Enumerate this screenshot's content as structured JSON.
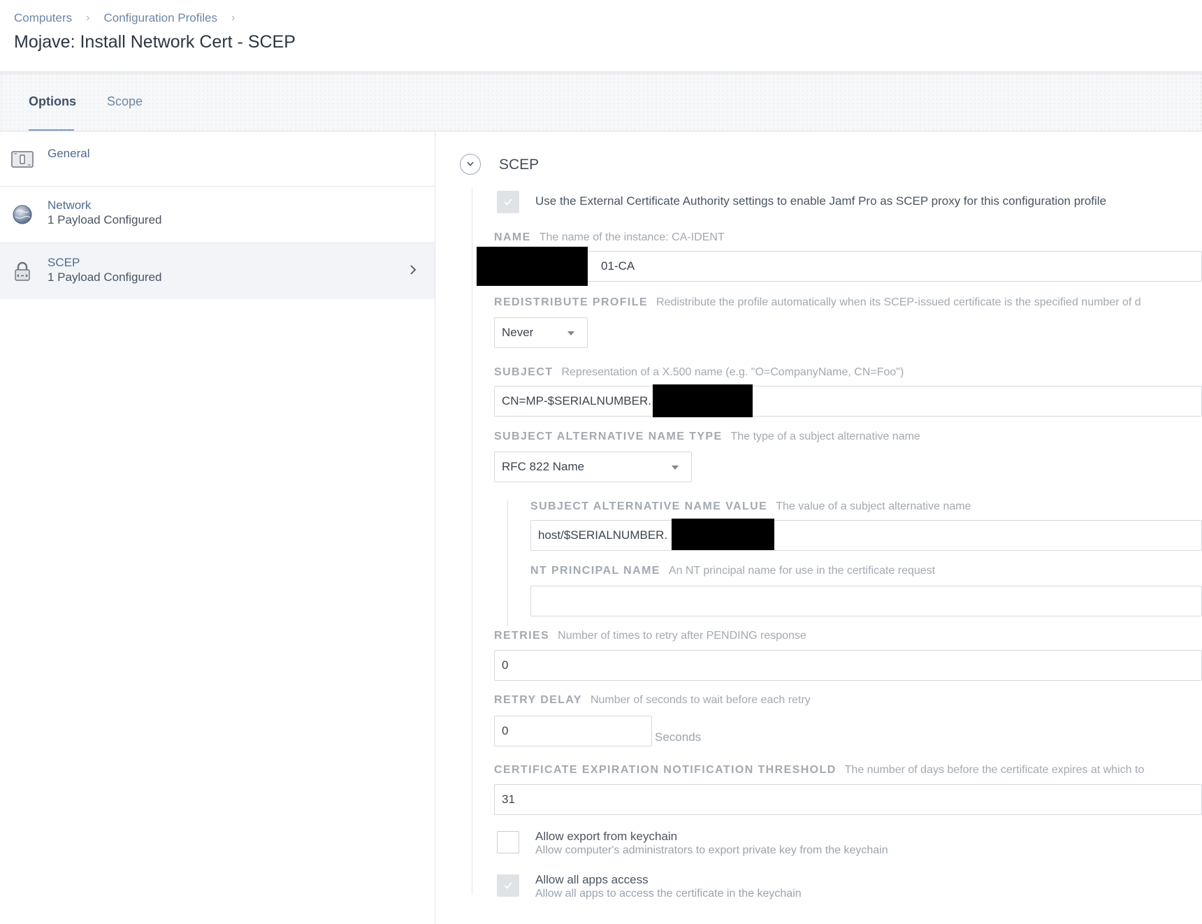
{
  "breadcrumb": {
    "items": [
      "Computers",
      "Configuration Profiles"
    ]
  },
  "page": {
    "title": "Mojave: Install Network Cert - SCEP"
  },
  "tabs": {
    "options": "Options",
    "scope": "Scope"
  },
  "sidebar": {
    "items": [
      {
        "label": "General",
        "icon": "switch-icon"
      },
      {
        "label": "Network",
        "sublabel": "1 Payload Configured",
        "icon": "globe-icon"
      },
      {
        "label": "SCEP",
        "sublabel": "1 Payload Configured",
        "icon": "padlock-icon",
        "selected": true
      }
    ]
  },
  "section": {
    "title": "SCEP",
    "external_ca_checkbox": {
      "label": "Use the External Certificate Authority settings to enable Jamf Pro as SCEP proxy for this configuration profile",
      "checked": true
    }
  },
  "fields": {
    "name": {
      "label": "NAME",
      "description": "The name of the instance: CA-IDENT",
      "value": "01-CA"
    },
    "redistribute": {
      "label": "REDISTRIBUTE PROFILE",
      "description": "Redistribute the profile automatically when its SCEP-issued certificate is the specified number of d",
      "value": "Never"
    },
    "subject": {
      "label": "SUBJECT",
      "description": "Representation of a X.500 name (e.g. \"O=CompanyName, CN=Foo\")",
      "value": "CN=MP-$SERIALNUMBER."
    },
    "san_type": {
      "label": "SUBJECT ALTERNATIVE NAME TYPE",
      "description": "The type of a subject alternative name",
      "value": "RFC 822 Name"
    },
    "san_value": {
      "label": "SUBJECT ALTERNATIVE NAME VALUE",
      "description": "The value of a subject alternative name",
      "value": "host/$SERIALNUMBER."
    },
    "nt_principal": {
      "label": "NT PRINCIPAL NAME",
      "description": "An NT principal name for use in the certificate request",
      "value": ""
    },
    "retries": {
      "label": "RETRIES",
      "description": "Number of times to retry after PENDING response",
      "value": "0"
    },
    "retry_delay": {
      "label": "RETRY DELAY",
      "description": "Number of seconds to wait before each retry",
      "value": "0",
      "unit": "Seconds"
    },
    "cert_expiration": {
      "label": "CERTIFICATE EXPIRATION NOTIFICATION THRESHOLD",
      "description": "The number of days before the certificate expires at which to",
      "value": "31"
    }
  },
  "options": {
    "allow_export": {
      "label": "Allow export from keychain",
      "description": "Allow computer's administrators to export private key from the keychain",
      "checked": false
    },
    "allow_all_apps": {
      "label": "Allow all apps access",
      "description": "Allow all apps to access the certificate in the keychain",
      "checked": true
    }
  },
  "colors": {
    "link": "#6f86a6",
    "accent_underline": "#7f9bc2",
    "label_gray": "#a2a9b2"
  }
}
